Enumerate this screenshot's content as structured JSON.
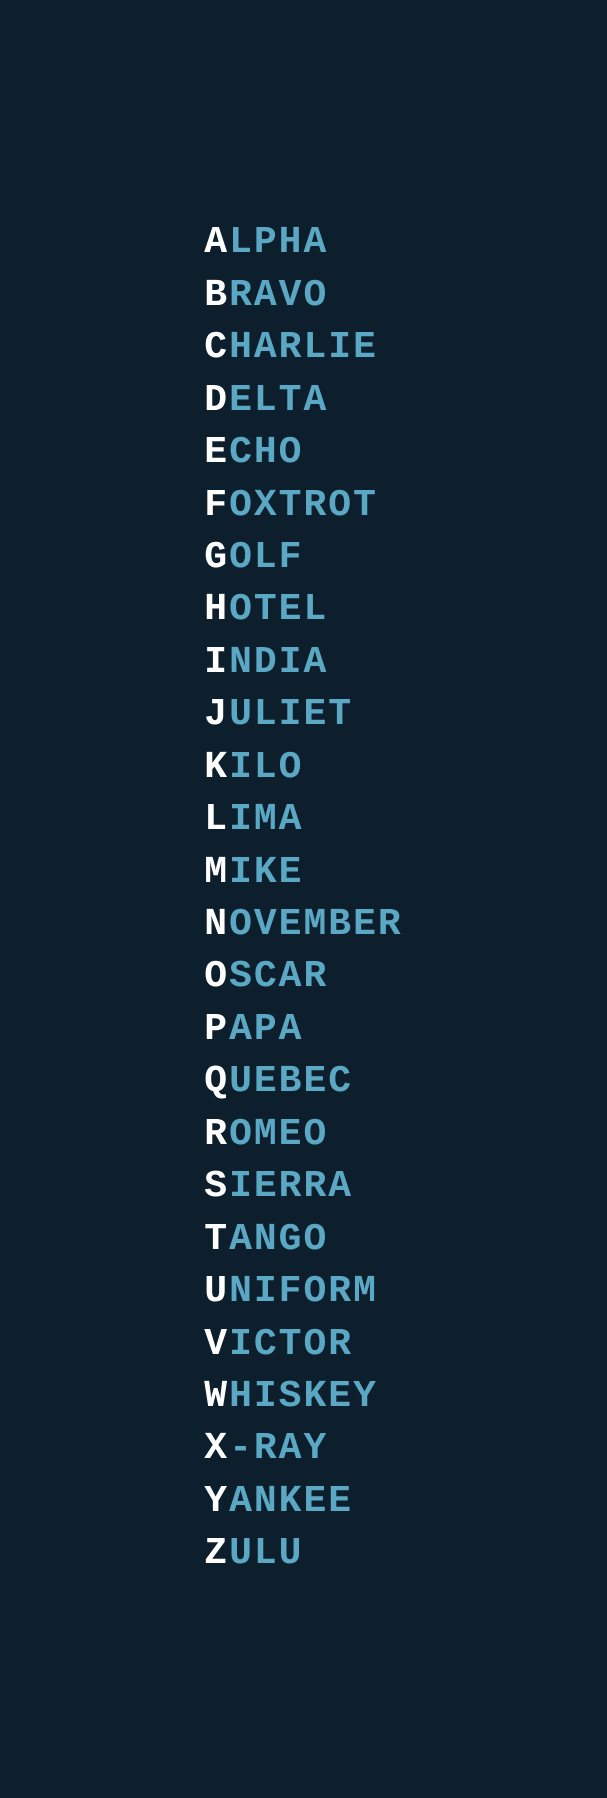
{
  "background": "#0d1f2d",
  "words": [
    {
      "letter": "A",
      "rest": "LPHA"
    },
    {
      "letter": "B",
      "rest": "RAVO"
    },
    {
      "letter": "C",
      "rest": "HARLIE"
    },
    {
      "letter": "D",
      "rest": "ELTA"
    },
    {
      "letter": "E",
      "rest": "CHO"
    },
    {
      "letter": "F",
      "rest": "OXTROT"
    },
    {
      "letter": "G",
      "rest": "OLF"
    },
    {
      "letter": "H",
      "rest": "OTEL"
    },
    {
      "letter": "I",
      "rest": "NDIA"
    },
    {
      "letter": "J",
      "rest": "ULIET"
    },
    {
      "letter": "K",
      "rest": "ILO"
    },
    {
      "letter": "L",
      "rest": "IMA"
    },
    {
      "letter": "M",
      "rest": "IKE"
    },
    {
      "letter": "N",
      "rest": "OVEMBER"
    },
    {
      "letter": "O",
      "rest": "SCAR"
    },
    {
      "letter": "P",
      "rest": "APA"
    },
    {
      "letter": "Q",
      "rest": "UEBEC"
    },
    {
      "letter": "R",
      "rest": "OMEO"
    },
    {
      "letter": "S",
      "rest": "IERRA"
    },
    {
      "letter": "T",
      "rest": "ANGO"
    },
    {
      "letter": "U",
      "rest": "NIFORM"
    },
    {
      "letter": "V",
      "rest": "ICTOR"
    },
    {
      "letter": "W",
      "rest": "HISKEY"
    },
    {
      "letter": "X",
      "rest": "-RAY"
    },
    {
      "letter": "Y",
      "rest": "ANKEE"
    },
    {
      "letter": "Z",
      "rest": "ULU"
    }
  ]
}
